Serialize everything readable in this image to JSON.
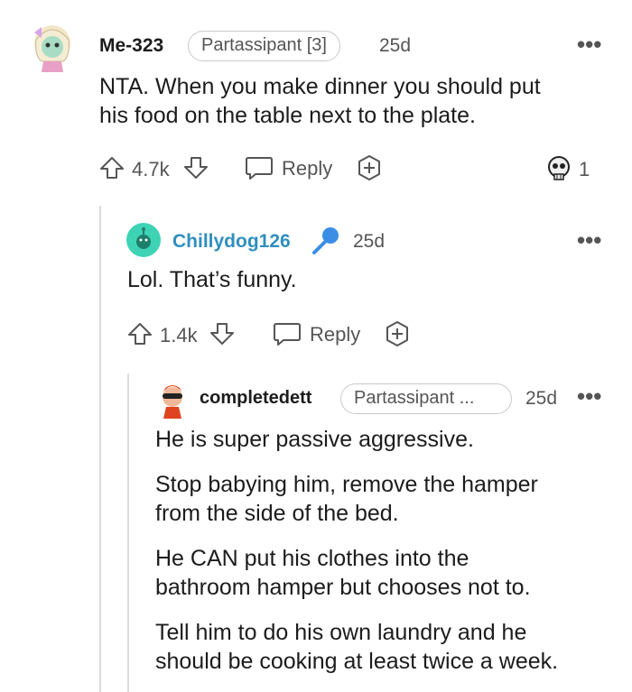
{
  "comments": [
    {
      "username": "Me-323",
      "flair": "Partassipant [3]",
      "age": "25d",
      "lines": [
        "NTA. When you make dinner you should put",
        "his food on the table next to the plate."
      ],
      "votes": "4.7k",
      "reply_label": "Reply",
      "award_count": "1",
      "more_label": "•••"
    },
    {
      "username": "Chillydog126",
      "username_color": "#2f8fbf",
      "age": "25d",
      "lines": [
        "Lol. That’s funny."
      ],
      "votes": "1.4k",
      "reply_label": "Reply",
      "more_label": "•••"
    },
    {
      "username": "completedett",
      "flair": "Partassipant ...",
      "age": "25d",
      "paragraphs": [
        [
          "He is super passive aggressive."
        ],
        [
          "Stop babying him, remove the hamper",
          "from the side of the bed."
        ],
        [
          "He CAN put his clothes into the",
          "bathroom hamper but chooses not to."
        ],
        [
          "Tell him to do his own laundry and he",
          "should be cooking at least twice a week."
        ]
      ],
      "more_label": "•••"
    }
  ],
  "icons": {
    "upvote": "upvote-arrow-icon",
    "downvote": "downvote-arrow-icon",
    "reply": "speech-bubble-icon",
    "award": "plus-award-icon",
    "skull": "skull-award-icon",
    "mic": "microphone-icon"
  },
  "colors": {
    "accent_blue": "#2f8fbf",
    "avatar_teal": "#3fd3b6",
    "mic_blue": "#3a8ee6"
  }
}
